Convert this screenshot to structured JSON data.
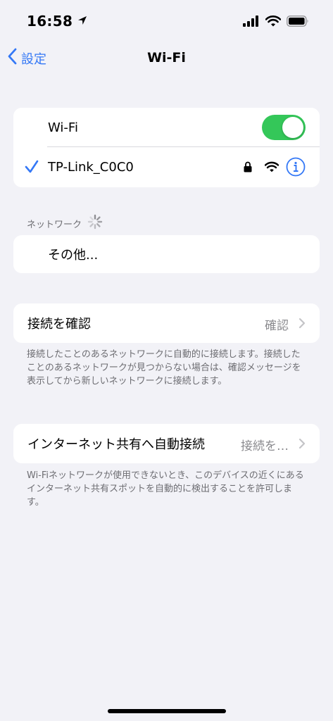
{
  "status_bar": {
    "time": "16:58",
    "icons": [
      "location-arrow-icon",
      "cellular-signal-icon",
      "wifi-icon",
      "battery-icon"
    ]
  },
  "nav": {
    "back_label": "設定",
    "title": "Wi-Fi"
  },
  "wifi_group": {
    "toggle_label": "Wi-Fi",
    "toggle_on": true,
    "connected_network": "TP-Link_C0C0"
  },
  "networks_section": {
    "header": "ネットワーク",
    "other_label": "その他..."
  },
  "ask_to_join": {
    "label": "接続を確認",
    "value": "確認",
    "footer": "接続したことのあるネットワークに自動的に接続します。接続したことのあるネットワークが見つからない場合は、確認メッセージを表示してから新しいネットワークに接続します。"
  },
  "auto_join_hotspot": {
    "label": "インターネット共有へ自動接続",
    "value": "接続を…",
    "footer": "Wi-Fiネットワークが使用できないとき、このデバイスの近くにあるインターネット共有スポットを自動的に検出することを許可します。"
  },
  "colors": {
    "accent": "#3478f6",
    "toggle_on": "#34c759",
    "background": "#f2f2f7"
  }
}
